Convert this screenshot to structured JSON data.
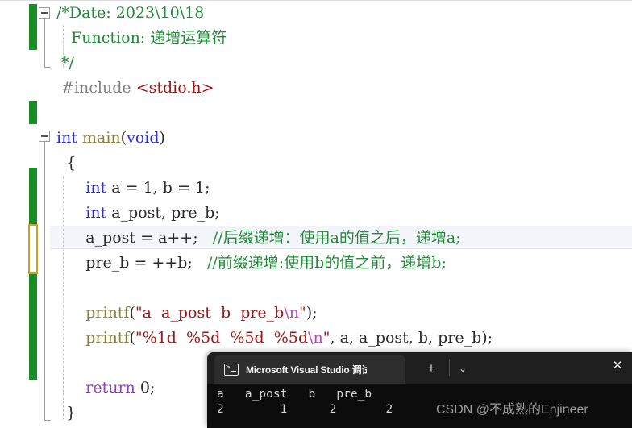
{
  "app": {
    "kind": "code-editor-with-terminal"
  },
  "editor": {
    "language": "C",
    "lines": [
      {
        "text": "/*Date: 2023\\10\\18"
      },
      {
        "text": "   Function: 递增运算符"
      },
      {
        "text": " */"
      },
      {
        "text": " #include <stdio.h>"
      },
      {
        "text": ""
      },
      {
        "text": "int main(void)"
      },
      {
        "text": "  {"
      },
      {
        "text": "      int a = 1, b = 1;"
      },
      {
        "text": "      int a_post, pre_b;"
      },
      {
        "text": "      a_post = a++;   //后缀递增：使用a的值之后，递增a;"
      },
      {
        "text": "      pre_b = ++b;   //前缀递增:使用b的值之前，递增b;"
      },
      {
        "text": ""
      },
      {
        "text": "      printf(\"a  a_post  b  pre_b\\n\");"
      },
      {
        "text": "      printf(\"%1d  %5d  %5d  %5d\\n\", a, a_post, b, pre_b);"
      },
      {
        "text": ""
      },
      {
        "text": "      return 0;"
      },
      {
        "text": "  }"
      }
    ],
    "colors": {
      "comment": "#1f8b36",
      "keyword": "#2a2ae0",
      "keyword_control": "#8b3fbf",
      "preprocessor": "#808080",
      "string": "#a31515",
      "escape": "#c040c0",
      "function": "#8a7d3a",
      "plain": "#2b2b2b",
      "change_bar_saved": "#1a8c24",
      "change_bar_unsaved": "#d4a017",
      "current_line_bg": "#f4f4fb",
      "background": "#ffffff"
    }
  },
  "terminal": {
    "tab": {
      "title": "Microsoft Visual Studio 调试控",
      "icon": "console-icon",
      "close_label": "✕"
    },
    "new_tab_label": "+",
    "dropdown_label": "⌄",
    "output": {
      "header": "a   a_post   b   pre_b",
      "values": "2        1      2       2",
      "columns": [
        "a",
        "a_post",
        "b",
        "pre_b"
      ],
      "row": [
        2,
        1,
        2,
        2
      ]
    }
  },
  "watermark": {
    "text": "CSDN @不成熟的Enjineer"
  }
}
